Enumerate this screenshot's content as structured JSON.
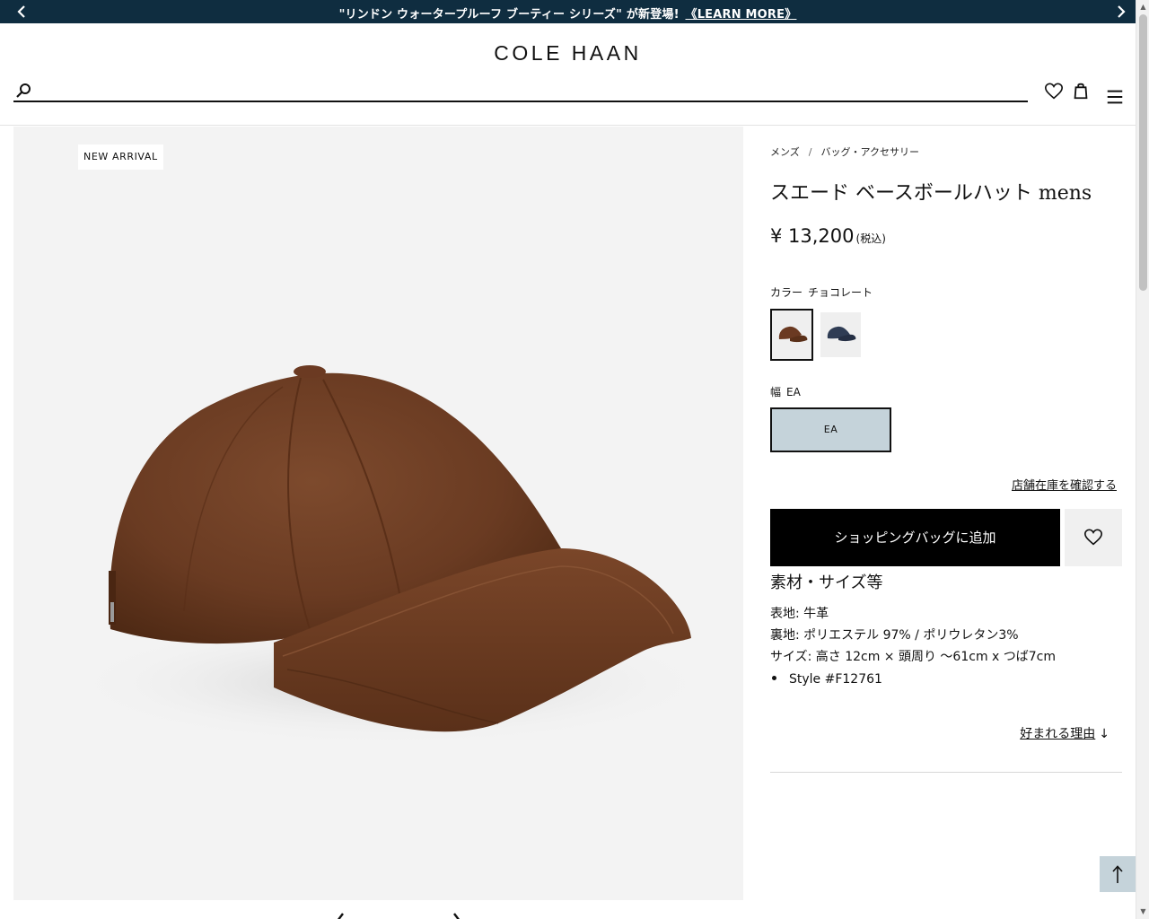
{
  "announcement": {
    "message": "\"リンドン ウォータープルーフ ブーティー シリーズ\" が新登場!",
    "link_text": "《LEARN MORE》",
    "prev_icon": "chevron-left-icon",
    "next_icon": "chevron-right-icon"
  },
  "header": {
    "logo": "COLE HAAN",
    "search_placeholder": "",
    "icons": [
      "search-icon",
      "heart-icon",
      "shopping-bag-icon",
      "menu-icon"
    ]
  },
  "gallery": {
    "badge": "NEW ARRIVAL",
    "image_description_icon": "suede-baseball-cap-image",
    "nav_icons": [
      "chevron-left-icon",
      "chevron-right-icon"
    ]
  },
  "product": {
    "breadcrumb": [
      "メンズ",
      "/",
      "バッグ・アクセサリー"
    ],
    "title": "スエード ベースボールハット mens",
    "price": "¥ 13,200",
    "price_tax": "(税込)",
    "color_label": "カラー",
    "color_value": "チョコレート",
    "swatches": [
      {
        "name": "チョコレート",
        "color": "#6b3a22",
        "selected": true
      },
      {
        "name": "navy",
        "color": "#2f3c54",
        "selected": false
      }
    ],
    "width_label": "幅",
    "width_value": "EA",
    "width_option": "EA",
    "store_link": "店舗在庫を確認する",
    "add_to_bag": "ショッピングバッグに追加",
    "section_title": "素材・サイズ等",
    "specs": [
      "表地: 牛革",
      "裏地: ポリエステル 97% / ポリウレタン3%",
      "サイズ: 高さ 12cm × 頭周り 〜61cm x つば7cm"
    ],
    "style_number": "Style #F12761",
    "why_link": "好まれる理由",
    "why_arrow": "↓"
  },
  "colors": {
    "announce_bg": "#0f2d40",
    "accent_blue": "#c5d3da",
    "button_black": "#000000",
    "cap_brown": "#6b3a22"
  }
}
